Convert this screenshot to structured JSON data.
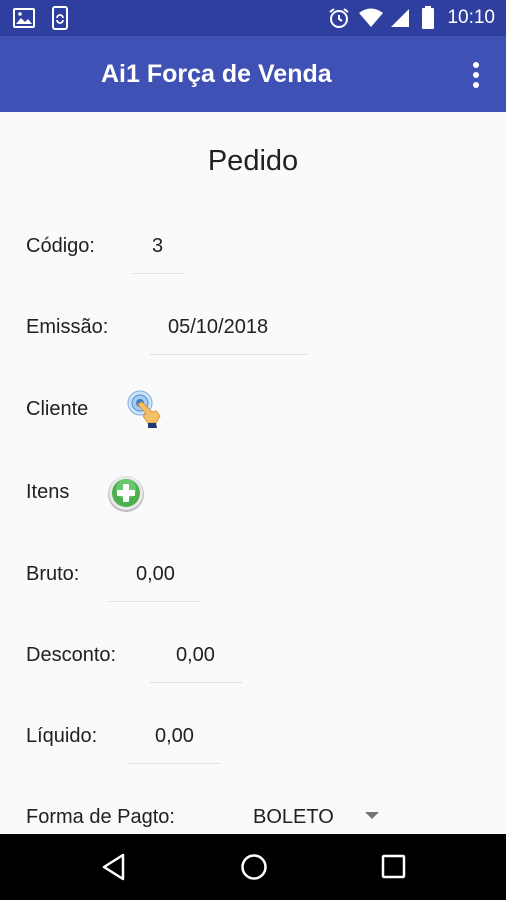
{
  "status_bar": {
    "time": "10:10",
    "left_icons": [
      "image-icon",
      "phone-sync-icon"
    ],
    "right_icons": [
      "alarm-icon",
      "wifi-icon",
      "signal-icon",
      "battery-icon"
    ]
  },
  "app_bar": {
    "title": "Ai1 Força de Venda",
    "menu_icon": "more-vert-icon",
    "color": "#3f51b5",
    "status_color": "#2f3fa0"
  },
  "form": {
    "title": "Pedido",
    "codigo": {
      "label": "Código:",
      "value": "3"
    },
    "emissao": {
      "label": "Emissão:",
      "value": "05/10/2018"
    },
    "cliente": {
      "label": "Cliente",
      "icon": "touch-select-icon"
    },
    "itens": {
      "label": "Itens",
      "icon": "add-circle-icon"
    },
    "bruto": {
      "label": "Bruto:",
      "value": "0,00"
    },
    "desconto": {
      "label": "Desconto:",
      "value": "0,00"
    },
    "liquido": {
      "label": "Líquido:",
      "value": "0,00"
    },
    "forma_pagto": {
      "label": "Forma de Pagto:",
      "value": "BOLETO"
    }
  },
  "nav_bar": {
    "buttons": [
      "back-icon",
      "home-icon",
      "recents-icon"
    ]
  }
}
